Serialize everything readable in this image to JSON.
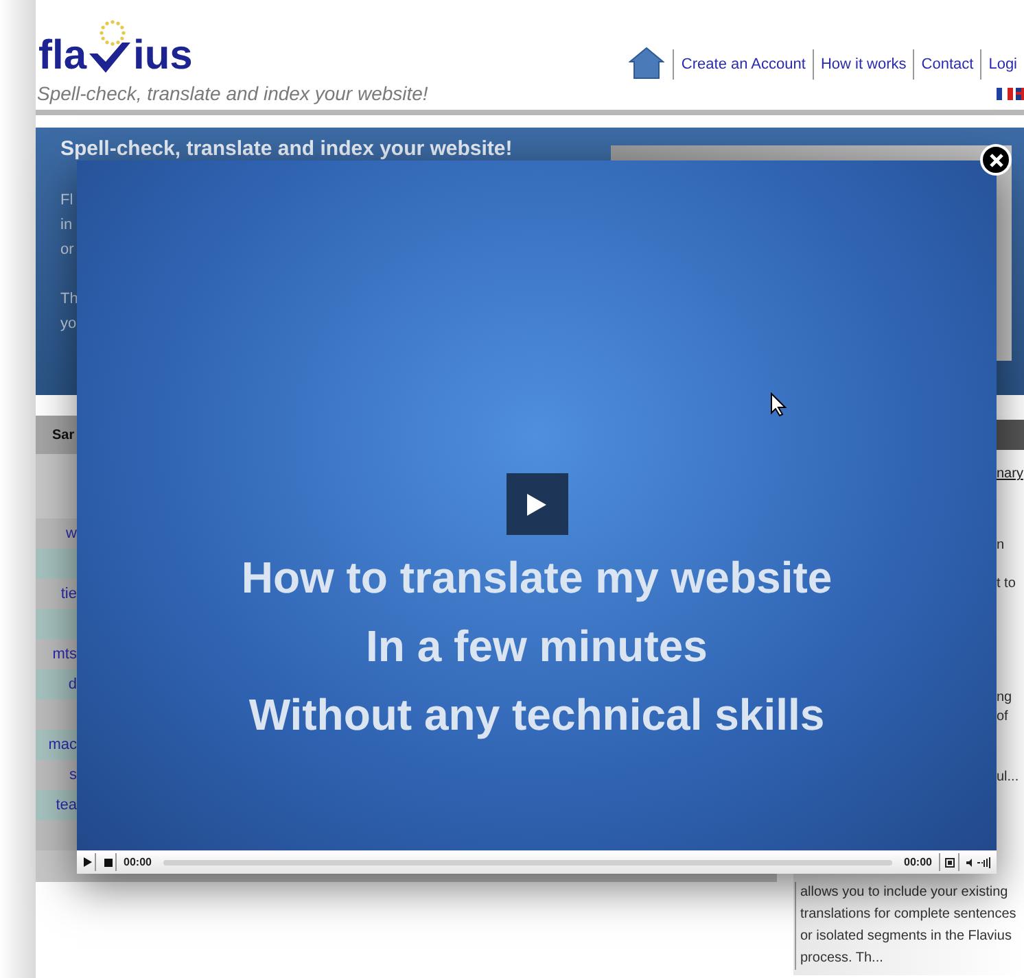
{
  "header": {
    "logo_left": "fla",
    "logo_right": "ius",
    "tagline": "Spell-check, translate and index your website!",
    "nav": [
      {
        "label": "Create an Account"
      },
      {
        "label": "How it works"
      },
      {
        "label": "Contact"
      },
      {
        "label": "Logi"
      }
    ]
  },
  "banner": {
    "title": "Spell-check, translate and index your website!",
    "fragments": [
      "Fl",
      "in",
      "or",
      "Th",
      "yo"
    ]
  },
  "left_panel": {
    "header": "Sar",
    "rows": [
      {
        "text": "w"
      },
      {},
      {
        "text": "tie"
      },
      {},
      {
        "text": "mts"
      },
      {
        "text": "d"
      },
      {},
      {
        "text": "mac"
      },
      {
        "text": "s"
      },
      {
        "text": "tea"
      },
      {}
    ]
  },
  "right_panel": {
    "link": "nary",
    "fragments": [
      "n",
      "t to",
      "ng",
      "of",
      "ul..."
    ],
    "paragraph": "allows you to include your existing translations for complete sentences or isolated segments in the Flavius process. Th..."
  },
  "video": {
    "lines": [
      "How to translate my website",
      "In a few minutes",
      "Without any technical skills"
    ],
    "current_time": "00:00",
    "duration": "00:00"
  }
}
